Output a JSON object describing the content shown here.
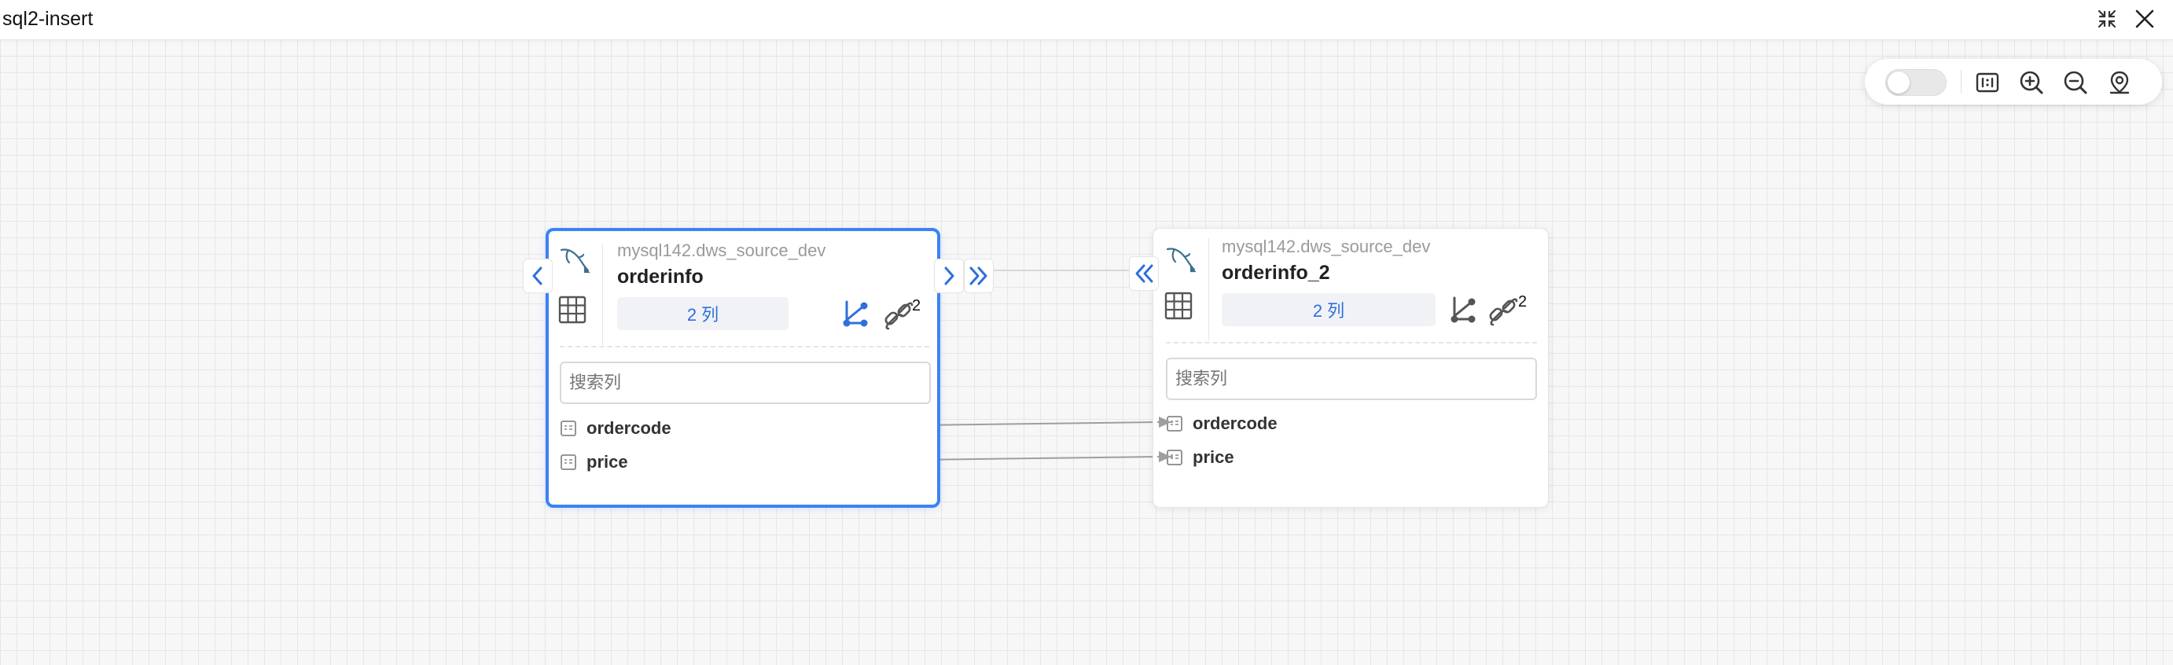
{
  "window": {
    "title": "sql2-insert"
  },
  "toolbar": {
    "toggle_on": false
  },
  "nodes": [
    {
      "db": "mysql142.dws_source_dev",
      "table": "orderinfo",
      "columns_badge": "2 列",
      "lineage_count": "2",
      "search_placeholder": "搜索列",
      "fields": [
        "ordercode",
        "price"
      ],
      "selected": true
    },
    {
      "db": "mysql142.dws_source_dev",
      "table": "orderinfo_2",
      "columns_badge": "2 列",
      "lineage_count": "2",
      "search_placeholder": "搜索列",
      "fields": [
        "ordercode",
        "price"
      ],
      "selected": false
    }
  ],
  "colors": {
    "accent": "#3b82f6",
    "badge_text": "#2f6fdd",
    "edge": "#9e9e9e",
    "canvas_bg": "#f7f7f7",
    "grid": "#e6e6e6"
  },
  "icons": {
    "db_logo": "mysql-dolphin-icon",
    "table": "table-grid-icon",
    "lineage": "branch-icon",
    "link": "link-icon",
    "field": "field-icon"
  }
}
